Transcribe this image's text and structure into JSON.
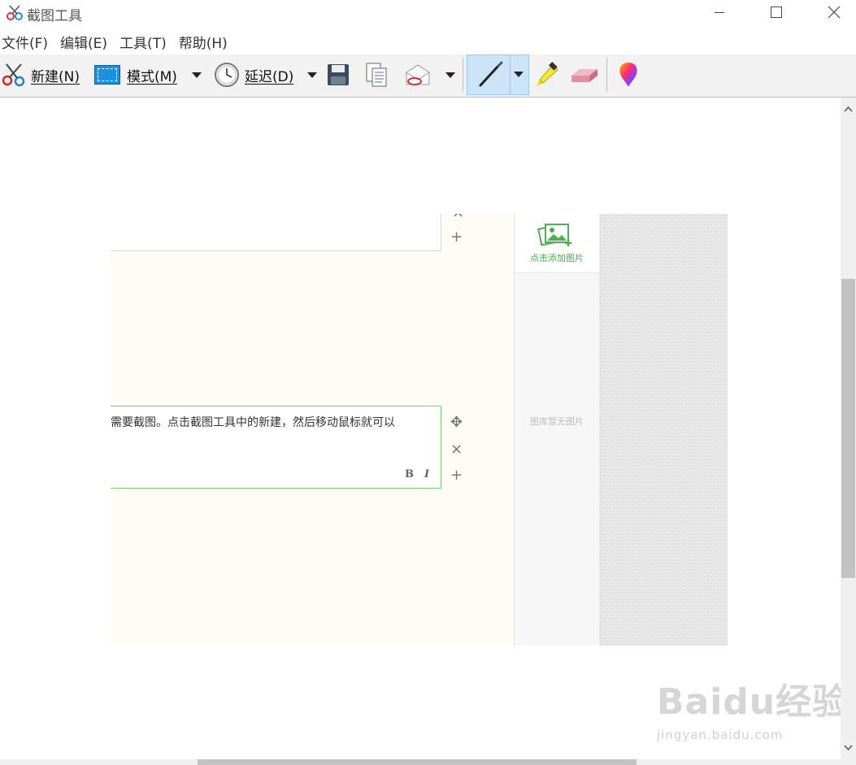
{
  "window": {
    "title": "截图工具",
    "controls": {
      "minimize": "—",
      "maximize": "☐",
      "close": "✕"
    }
  },
  "menu": [
    {
      "label": "文件(F)"
    },
    {
      "label": "编辑(E)"
    },
    {
      "label": "工具(T)"
    },
    {
      "label": "帮助(H)"
    }
  ],
  "toolbar": {
    "new_label": "新建(N)",
    "mode_label": "模式(M)",
    "delay_label": "延迟(D)",
    "icons": [
      "scissors-icon",
      "rectangle-mode-icon",
      "clock-icon",
      "save-icon",
      "copy-icon",
      "send-mail-icon",
      "pen-icon",
      "highlighter-icon",
      "eraser-icon",
      "paint3d-icon"
    ]
  },
  "snip": {
    "text_line": "需要截图。点击截图工具中的新建，然后移动鼠标就可以",
    "bold_btn": "B",
    "italic_btn": "I",
    "move_ctrl": "✥",
    "close_ctrl": "×",
    "add_ctrl": "+",
    "add_image_label": "点击添加图片",
    "empty_gallery": "图库暂无图片"
  },
  "watermark": {
    "main": "Baidu经验",
    "sub": "jingyan.baidu.com"
  },
  "colors": {
    "toolbar_bg": "#f2f2f2",
    "pen_active_bg": "#cce4f7",
    "accent_green": "#4caf50",
    "editor_bg": "#fdfdf5"
  }
}
